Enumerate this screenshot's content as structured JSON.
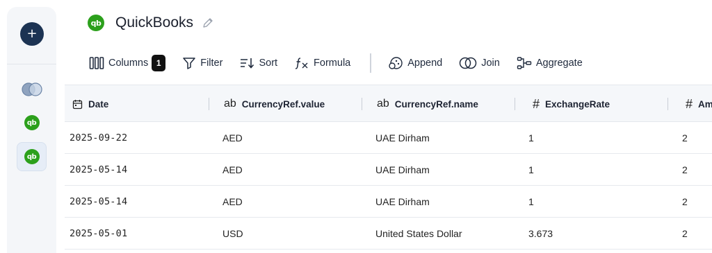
{
  "sidebar": {
    "add_label": "+",
    "items": [
      {
        "name": "join-icon"
      },
      {
        "name": "quickbooks-icon",
        "logo_text": "qb"
      },
      {
        "name": "quickbooks-icon",
        "logo_text": "qb",
        "active": true
      }
    ]
  },
  "header": {
    "logo_text": "qb",
    "title": "QuickBooks"
  },
  "toolbar": {
    "columns_label": "Columns",
    "columns_count": "1",
    "filter_label": "Filter",
    "sort_label": "Sort",
    "formula_label": "Formula",
    "append_label": "Append",
    "join_label": "Join",
    "aggregate_label": "Aggregate"
  },
  "table": {
    "columns": [
      {
        "label": "Date",
        "type_icon": "calendar-icon"
      },
      {
        "label": "CurrencyRef.value",
        "type_icon": "ab"
      },
      {
        "label": "CurrencyRef.name",
        "type_icon": "ab"
      },
      {
        "label": "ExchangeRate",
        "type_icon": "#"
      },
      {
        "label": "Am",
        "type_icon": "#"
      }
    ],
    "rows": [
      [
        "2025-09-22",
        "AED",
        "UAE Dirham",
        "1",
        "2"
      ],
      [
        "2025-05-14",
        "AED",
        "UAE Dirham",
        "1",
        "2"
      ],
      [
        "2025-05-14",
        "AED",
        "UAE Dirham",
        "1",
        "2"
      ],
      [
        "2025-05-01",
        "USD",
        "United States Dollar",
        "3.673",
        "2"
      ]
    ]
  },
  "colors": {
    "brand_green": "#2ca01c",
    "navy": "#1c3353"
  }
}
